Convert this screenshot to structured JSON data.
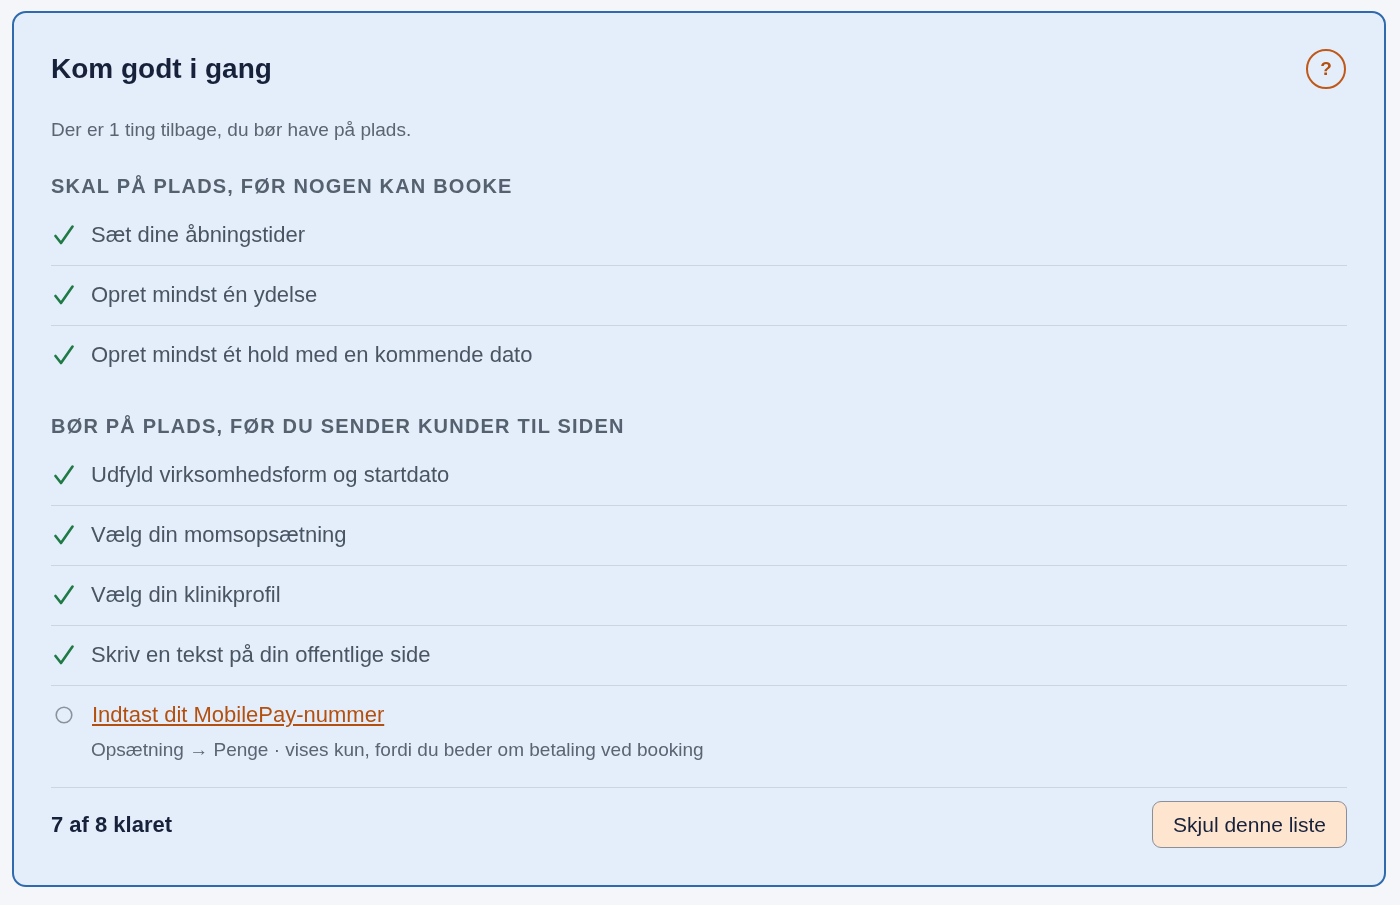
{
  "card": {
    "title": "Kom godt i gang",
    "help_button": "?",
    "summary": "Der er 1 ting tilbage, du bør have på plads.",
    "sections": [
      {
        "heading": "SKAL PÅ PLADS, FØR NOGEN KAN BOOKE",
        "items": [
          {
            "label": "Sæt dine åbningstider",
            "done": true
          },
          {
            "label": "Opret mindst én ydelse",
            "done": true
          },
          {
            "label": "Opret mindst ét hold med en kommende dato",
            "done": true
          }
        ]
      },
      {
        "heading": "BØR PÅ PLADS, FØR DU SENDER KUNDER TIL SIDEN",
        "items": [
          {
            "label": "Udfyld virksomhedsform og startdato",
            "done": true
          },
          {
            "label": "Vælg din momsopsætning",
            "done": true
          },
          {
            "label": "Vælg din klinikprofil",
            "done": true
          },
          {
            "label": "Skriv en tekst på din offentlige side",
            "done": true
          },
          {
            "label": "Indtast dit MobilePay-nummer",
            "done": false,
            "note": "Opsætning → Penge · vises kun, fordi du beder om betaling ved booking"
          }
        ]
      }
    ],
    "footer": {
      "progress": "7 af 8 klaret",
      "hide_button": "Skjul denne liste"
    }
  }
}
